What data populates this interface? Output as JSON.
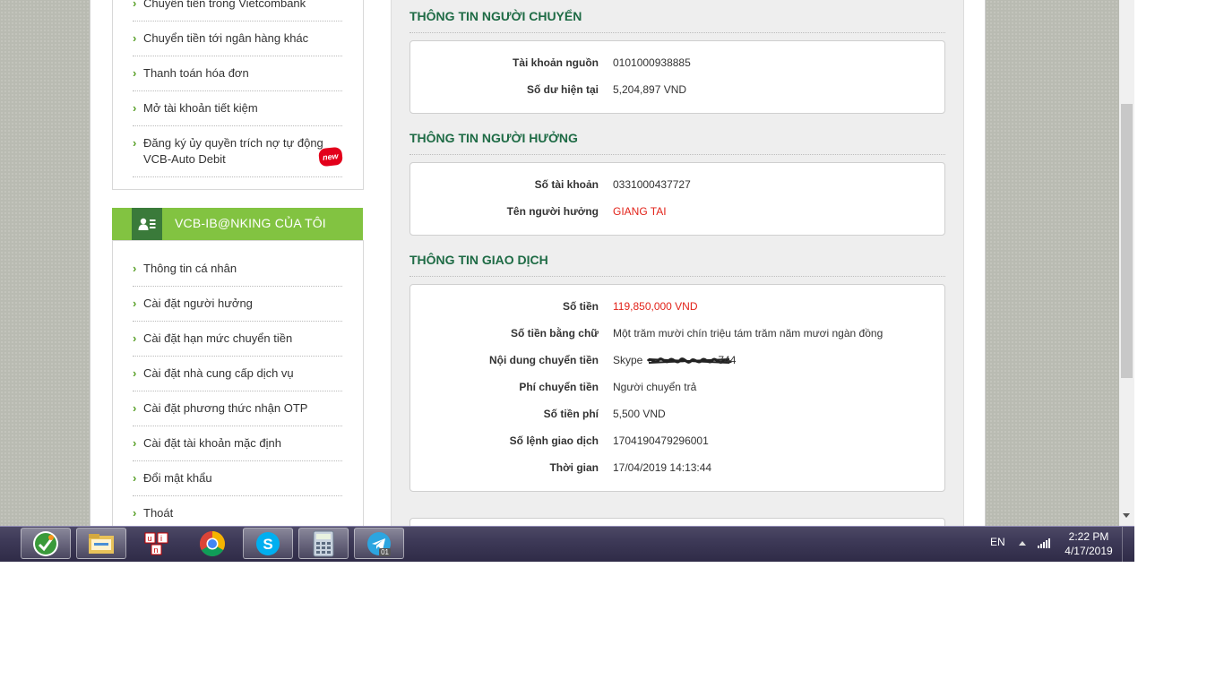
{
  "menu_top": {
    "items": [
      {
        "label": "Chuyển tiền trong Vietcombank"
      },
      {
        "label": "Chuyển tiền tới ngân hàng khác"
      },
      {
        "label": "Thanh toán hóa đơn"
      },
      {
        "label": "Mở tài khoản tiết kiệm"
      },
      {
        "label_line1": "Đăng ký ủy quyền trích nợ tự động",
        "label_line2": "VCB-Auto Debit",
        "badge": "new"
      }
    ]
  },
  "menu_mine": {
    "title": "VCB-IB@NKING CỦA TÔI",
    "items": [
      {
        "label": "Thông tin cá nhân"
      },
      {
        "label": "Cài đặt người hưởng"
      },
      {
        "label": "Cài đặt hạn mức chuyển tiền"
      },
      {
        "label": "Cài đặt nhà cung cấp dịch vụ"
      },
      {
        "label": "Cài đặt phương thức nhận OTP"
      },
      {
        "label": "Cài đặt tài khoản mặc định"
      },
      {
        "label": "Đổi mật khẩu"
      },
      {
        "label": "Thoát"
      }
    ]
  },
  "sender": {
    "title": "THÔNG TIN NGƯỜI CHUYỂN",
    "rows": [
      {
        "label": "Tài khoản nguồn",
        "value": "0101000938885"
      },
      {
        "label": "Số dư hiện tại",
        "value": "5,204,897 VND"
      }
    ]
  },
  "beneficiary": {
    "title": "THÔNG TIN NGƯỜI HƯỞNG",
    "rows": [
      {
        "label": "Số tài khoản",
        "value": "0331000437727"
      },
      {
        "label": "Tên người hưởng",
        "value": "GIANG TAI"
      }
    ]
  },
  "transaction": {
    "title": "THÔNG TIN GIAO DỊCH",
    "rows": [
      {
        "label": "Số tiền",
        "value": "119,850,000 VND"
      },
      {
        "label": "Số tiền bằng chữ",
        "value": "Một trăm mười chín triệu tám trăm năm mươi ngàn đồng"
      },
      {
        "label": "Nội dung chuyển tiền",
        "value": "Skype",
        "value_suffix": "744"
      },
      {
        "label": "Phí chuyển tiền",
        "value": "Người chuyển trả"
      },
      {
        "label": "Số tiền phí",
        "value": "5,500 VND"
      },
      {
        "label": "Số lệnh giao dịch",
        "value": "1704190479296001"
      },
      {
        "label": "Thời gian",
        "value": "17/04/2019 14:13:44"
      }
    ]
  },
  "colors": {
    "accent_green": "#82c341",
    "title_green": "#1e6b45",
    "highlight_red": "#e2231a"
  },
  "taskbar": {
    "apps": [
      {
        "icon": "coccoc-icon"
      },
      {
        "icon": "file-explorer-icon"
      },
      {
        "icon": "unikey-icon"
      },
      {
        "icon": "chrome-icon"
      },
      {
        "icon": "skype-icon"
      },
      {
        "icon": "calculator-icon"
      },
      {
        "icon": "telegram-icon",
        "badge": "01"
      }
    ],
    "language": "EN",
    "time": "2:22 PM",
    "date": "4/17/2019"
  }
}
